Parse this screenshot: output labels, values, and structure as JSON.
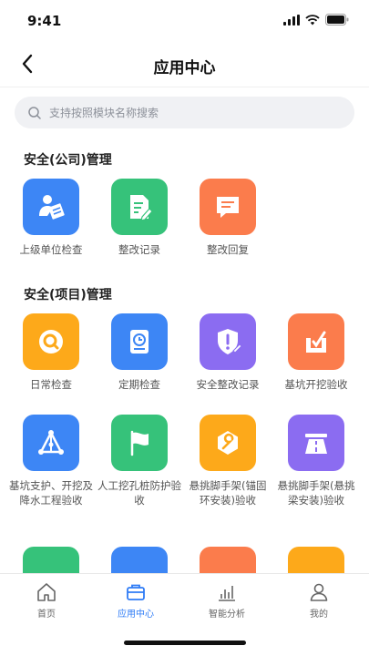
{
  "status_bar": {
    "time": "9:41"
  },
  "header": {
    "title": "应用中心"
  },
  "search": {
    "placeholder": "支持按照模块名称搜索"
  },
  "sections": [
    {
      "title": "安全(公司)管理",
      "items": [
        {
          "label": "上级单位检查",
          "icon": "person-edit-icon",
          "color": "#3d86f5"
        },
        {
          "label": "整改记录",
          "icon": "document-edit-icon",
          "color": "#36c27a"
        },
        {
          "label": "整改回复",
          "icon": "message-icon",
          "color": "#fb7c4c"
        }
      ]
    },
    {
      "title": "安全(项目)管理",
      "items": [
        {
          "label": "日常检查",
          "icon": "search-circle-icon",
          "color": "#fda91a"
        },
        {
          "label": "定期检查",
          "icon": "clock-book-icon",
          "color": "#3d86f5"
        },
        {
          "label": "安全整改记录",
          "icon": "shield-alert-icon",
          "color": "#8b6cf1"
        },
        {
          "label": "基坑开挖验收",
          "icon": "excavation-icon",
          "color": "#fb7c4c"
        },
        {
          "label": "基坑支护、开挖及降水工程验收",
          "icon": "triangle-nodes-icon",
          "color": "#3d86f5"
        },
        {
          "label": "人工挖孔桩防护验收",
          "icon": "flag-icon",
          "color": "#36c27a"
        },
        {
          "label": "悬挑脚手架(锚固环安装)验收",
          "icon": "wrench-icon",
          "color": "#fda91a"
        },
        {
          "label": "悬挑脚手架(悬挑梁安装)验收",
          "icon": "road-icon",
          "color": "#8b6cf1"
        }
      ]
    }
  ],
  "partial_row_colors": [
    "#36c27a",
    "#3d86f5",
    "#fb7c4c",
    "#fda91a"
  ],
  "tabs": [
    {
      "label": "首页",
      "icon": "home-icon"
    },
    {
      "label": "应用中心",
      "icon": "briefcase-icon",
      "active": true
    },
    {
      "label": "智能分析",
      "icon": "bar-chart-icon"
    },
    {
      "label": "我的",
      "icon": "user-icon"
    }
  ],
  "colors": {
    "accent": "#2f7cf6",
    "tab_inactive": "#666666"
  }
}
